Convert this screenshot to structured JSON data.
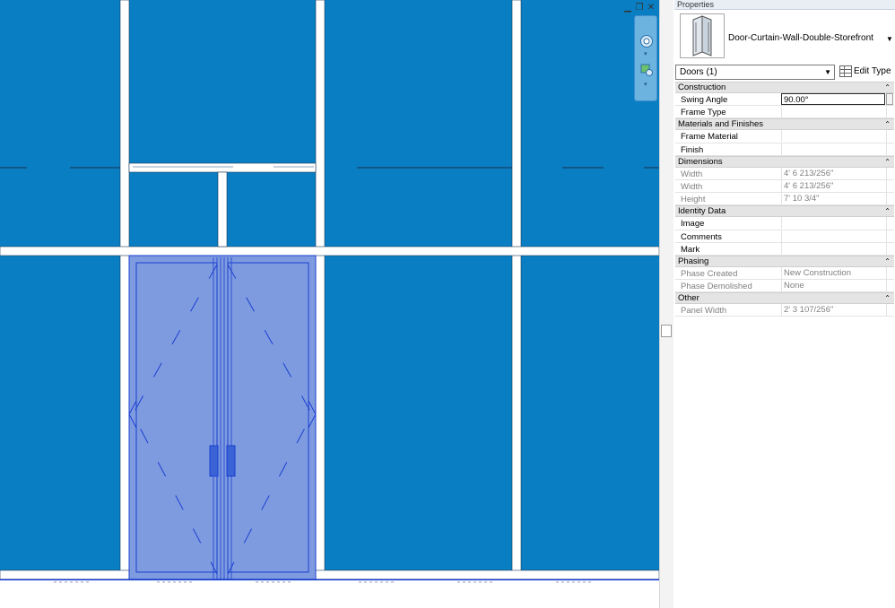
{
  "viewport": {
    "colors": {
      "glass": "#0a7ec2",
      "mullion": "#ffffff",
      "door_highlight": "#7f9be0",
      "door_lines": "#1a3fcf"
    }
  },
  "properties": {
    "title": "Properties",
    "type_name": "Door-Curtain-Wall-Double-Storefront",
    "instance_filter": "Doors (1)",
    "edit_type_label": "Edit Type",
    "groups": [
      {
        "name": "Construction",
        "rows": [
          {
            "key": "Swing Angle",
            "value": "90.00°",
            "editing": true
          },
          {
            "key": "Frame Type",
            "value": ""
          }
        ]
      },
      {
        "name": "Materials and Finishes",
        "rows": [
          {
            "key": "Frame Material",
            "value": ""
          },
          {
            "key": "Finish",
            "value": ""
          }
        ]
      },
      {
        "name": "Dimensions",
        "rows": [
          {
            "key": "Width",
            "value": "4'  6 213/256\"",
            "readonly": true
          },
          {
            "key": "Width",
            "value": "4'  6 213/256\"",
            "readonly": true
          },
          {
            "key": "Height",
            "value": "7'  10 3/4\"",
            "readonly": true
          }
        ]
      },
      {
        "name": "Identity Data",
        "rows": [
          {
            "key": "Image",
            "value": ""
          },
          {
            "key": "Comments",
            "value": ""
          },
          {
            "key": "Mark",
            "value": ""
          }
        ]
      },
      {
        "name": "Phasing",
        "rows": [
          {
            "key": "Phase Created",
            "value": "New Construction",
            "readonly": true
          },
          {
            "key": "Phase Demolished",
            "value": "None",
            "readonly": true
          }
        ]
      },
      {
        "name": "Other",
        "rows": [
          {
            "key": "Panel Width",
            "value": "2'  3 107/256\"",
            "readonly": true
          }
        ]
      }
    ]
  }
}
